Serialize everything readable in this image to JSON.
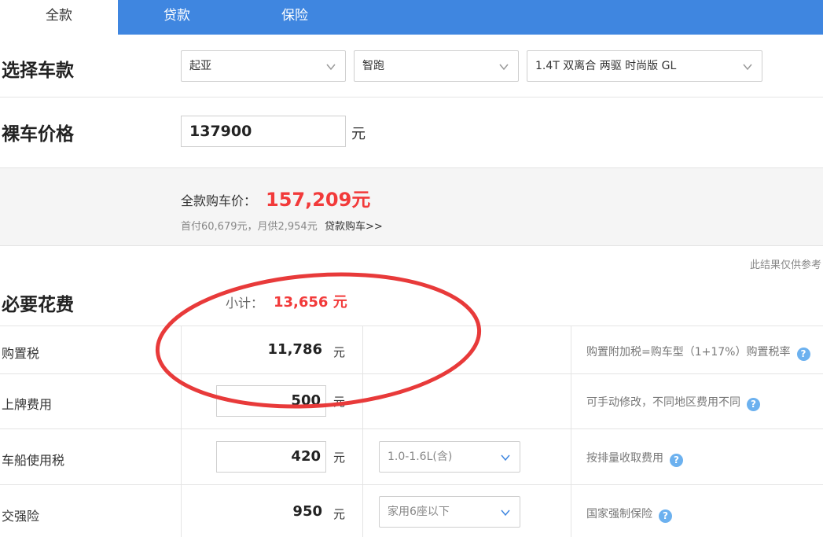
{
  "tabs": [
    {
      "label": "全款",
      "active": true
    },
    {
      "label": "贷款",
      "active": false
    },
    {
      "label": "保险",
      "active": false
    }
  ],
  "select_model": {
    "title": "选择车款",
    "brand": "起亚",
    "series": "智跑",
    "version": "1.4T 双离合 两驱 时尚版 GL"
  },
  "bare_price": {
    "title": "裸车价格",
    "value": "137900",
    "unit": "元"
  },
  "summary": {
    "label": "全款购车价：",
    "value": "157,209元",
    "sub": "首付60,679元，月供2,954元",
    "link": "贷款购车>>"
  },
  "note": "此结果仅供参考",
  "required": {
    "title": "必要花费",
    "subtotal_label": "小计：",
    "subtotal_value": "13,656 元",
    "rows": [
      {
        "label": "购置税",
        "value": "11,786",
        "unit": "元",
        "desc": "购置附加税=购车型（1+17%）购置税率"
      },
      {
        "label": "上牌费用",
        "value": "500",
        "unit": "元",
        "desc": "可手动修改，不同地区费用不同"
      },
      {
        "label": "车船使用税",
        "value": "420",
        "unit": "元",
        "option": "1.0-1.6L(含)",
        "desc": "按排量收取费用"
      },
      {
        "label": "交强险",
        "value": "950",
        "unit": "元",
        "option": "家用6座以下",
        "desc": "国家强制保险"
      }
    ]
  },
  "help_glyph": "?",
  "colors": {
    "tab_bar": "#3f86e0",
    "price_red": "#f23a3a",
    "annotation_red": "#e83a3a",
    "help_blue": "#6cb1ef"
  }
}
